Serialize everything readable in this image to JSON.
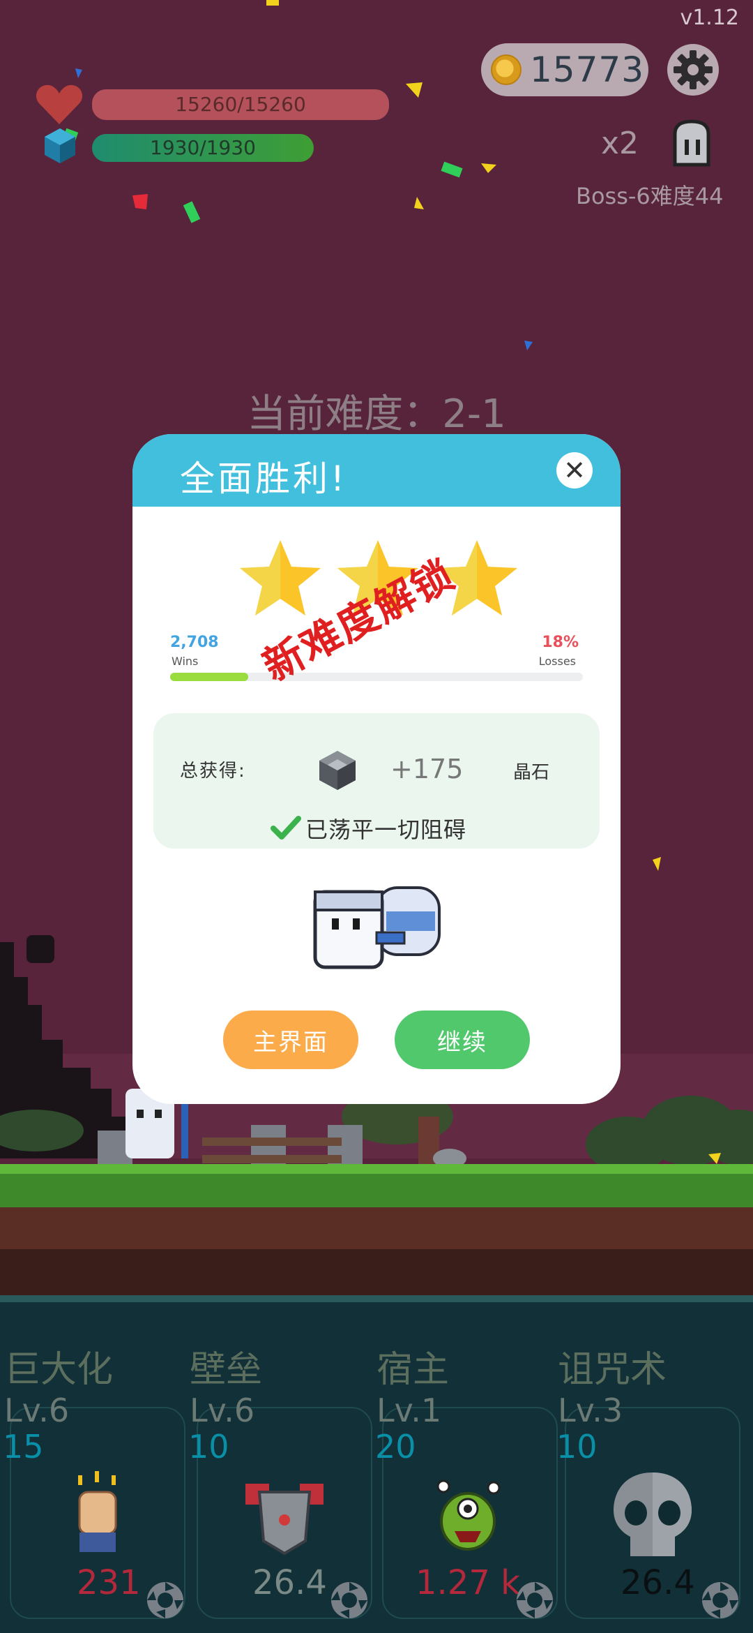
{
  "hud": {
    "version": "v1.12",
    "coins": "15773",
    "hp": "15260/15260",
    "mana": "1930/1930",
    "speed_multiplier": "x2",
    "boss_info": "Boss-6难度44",
    "current_difficulty": "当前难度：2-1"
  },
  "dialog": {
    "title": "全面胜利!",
    "stars_earned": 3,
    "stats": {
      "wins_value": "2,708",
      "wins_label": "Wins",
      "losses_value": "18%",
      "losses_label": "Losses",
      "progress_fraction": 0.19
    },
    "stamp_text": "新难度解锁",
    "reward": {
      "label": "总获得:",
      "amount": "+175",
      "item_name": "晶石"
    },
    "clear_message": "已荡平一切阻碍",
    "buttons": {
      "home": "主界面",
      "continue": "继续"
    }
  },
  "skills": [
    {
      "name": "巨大化",
      "level": "Lv.6",
      "cost": "15",
      "value": "231",
      "value_color": "#b3283a",
      "icon": "fist-icon"
    },
    {
      "name": "壁垒",
      "level": "Lv.6",
      "cost": "10",
      "value": "26.4",
      "value_color": "#7b8a86",
      "icon": "armor-icon"
    },
    {
      "name": "宿主",
      "level": "Lv.1",
      "cost": "20",
      "value": "1.27 k",
      "value_color": "#b3283a",
      "icon": "monster-icon"
    },
    {
      "name": "诅咒术",
      "level": "Lv.3",
      "cost": "10",
      "value": "26.4",
      "value_color": "#0a0f12",
      "icon": "skull-icon"
    }
  ],
  "colors": {
    "sky": "#58243b",
    "dialog_header": "#41bfdc",
    "home_button": "#fbab4a",
    "continue_button": "#52c86c",
    "stamp": "#e02020"
  }
}
